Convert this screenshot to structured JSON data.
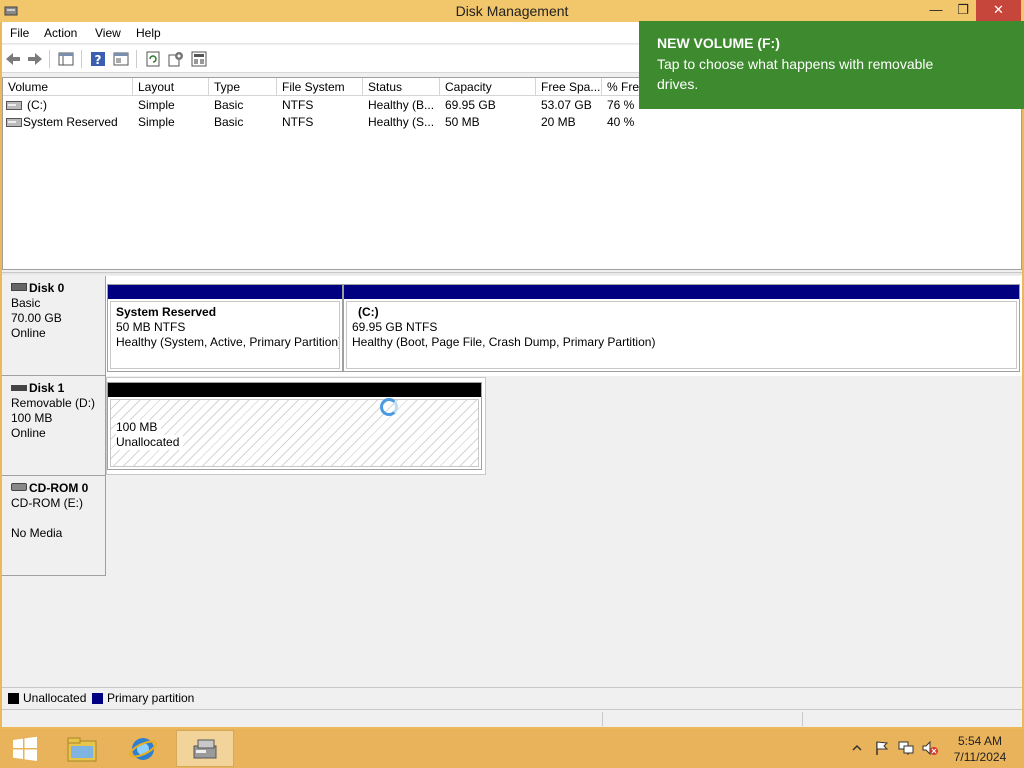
{
  "window": {
    "title": "Disk Management",
    "min_glyph": "—",
    "max_glyph": "❐",
    "close_glyph": "✕"
  },
  "menu": {
    "file": "File",
    "action": "Action",
    "view": "View",
    "help": "Help"
  },
  "toolbar": {
    "icons": [
      "back-arrow-icon",
      "forward-arrow-icon",
      "console-tree-icon",
      "help-icon",
      "properties-icon",
      "refresh-icon",
      "settings-icon",
      "export-icon"
    ]
  },
  "volume_list": {
    "columns": [
      "Volume",
      "Layout",
      "Type",
      "File System",
      "Status",
      "Capacity",
      "Free Spa...",
      "% Free"
    ],
    "rows": [
      [
        "(C:)",
        "Simple",
        "Basic",
        "NTFS",
        "Healthy (B...",
        "69.95 GB",
        "53.07 GB",
        "76 %"
      ],
      [
        "System Reserved",
        "Simple",
        "Basic",
        "NTFS",
        "Healthy (S...",
        "50 MB",
        "20 MB",
        "40 %"
      ]
    ]
  },
  "disks": {
    "disk0": {
      "name": "Disk 0",
      "type": "Basic",
      "size": "70.00 GB",
      "state": "Online",
      "partitions": [
        {
          "name": "System Reserved",
          "size": "50 MB NTFS",
          "status": "Healthy (System, Active, Primary Partition)"
        },
        {
          "name": "(C:)",
          "size": "69.95 GB NTFS",
          "status": "Healthy (Boot, Page File, Crash Dump, Primary Partition)"
        }
      ]
    },
    "disk1": {
      "name": "Disk 1",
      "type": "Removable (D:)",
      "size": "100 MB",
      "state": "Online",
      "partitions": [
        {
          "size": "100 MB",
          "status": "Unallocated"
        }
      ]
    },
    "cdrom0": {
      "name": "CD-ROM 0",
      "type": "CD-ROM (E:)",
      "state": "No Media"
    }
  },
  "legend": {
    "unallocated": "Unallocated",
    "primary": "Primary partition",
    "unallocated_color": "#000000",
    "primary_color": "#000080"
  },
  "toast": {
    "title": "NEW VOLUME (F:)",
    "body": "Tap to choose what happens with removable drives.",
    "color": "#3d8b2e"
  },
  "taskbar": {
    "apps": [
      "file-explorer-icon",
      "internet-explorer-icon",
      "disk-management-icon"
    ],
    "time": "5:54 AM",
    "date": "7/11/2024"
  }
}
